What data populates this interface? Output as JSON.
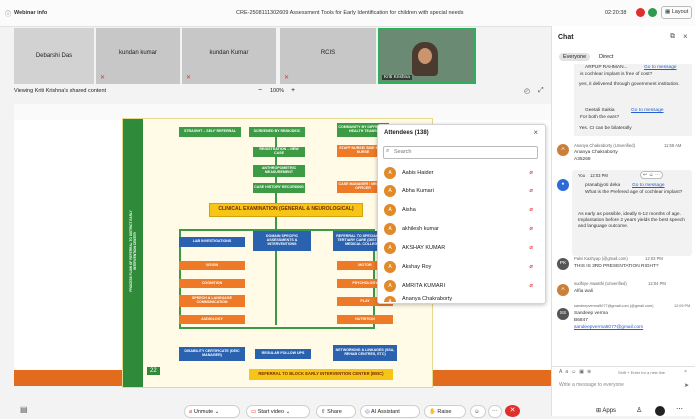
{
  "app": {
    "title": "Webinar info",
    "meeting_title": "CRE-2508111302609 Assessment Tools for Early Identification for children with special needs",
    "time": "02:20:38",
    "layout_label": "Layout"
  },
  "participants": [
    {
      "name": "Debarshi Das"
    },
    {
      "name": "kundan kumar"
    },
    {
      "name": "kundan Kumar"
    },
    {
      "name": "RCIS"
    },
    {
      "name": "Kriti Krishna"
    }
  ],
  "share": {
    "label": "Viewing Kriti Krishna's shared content",
    "zoom": "100%",
    "minus": "−",
    "plus": "+"
  },
  "slide": {
    "vertical_text": "PROCESS FLOW OF REFERRAL TO DISTRICT EARLY INTERVENTION CENTER",
    "page_number": "22",
    "boxes": {
      "b1": "STRAIGHT – SELF REFERRAL",
      "b2": "SCREENED BY RBSK/DEIC",
      "b3": "COMMUNITY BY DIFFERENT HEALTH TEAMS",
      "b4": "REGISTRATION – NEW CASE",
      "b5": "STAFF NURSE/ SIDE STAFF NURSE",
      "b6": "ANTHROPOMETRIC MEASUREMENT",
      "b7": "CASE HISTORY RECORDING",
      "b8": "CASE MANAGER / MEDICAL OFFICER",
      "b9": "CLINICAL EXAMINATION (GENERAL & NEUROLOGICAL)",
      "b10": "LAB INVESTIGATIONS",
      "b11": "DOMAIN SPECIFIC ASSESSMENTS & INTERVENTIONS",
      "b12": "REFERRAL TO SPECIALISTS & TERTIARY CARE (DISTRICT & MEDICAL COLLEGE)",
      "l1": "VISION",
      "l2": "COGNITION",
      "l3": "SPEECH & LANGUAGE COMMUNICATION",
      "l4": "AUDIOLOGY",
      "r1": "MOTOR",
      "r2": "PSYCHOLOGY",
      "r3": "PLAY",
      "r4": "NUTRITION",
      "c1": "DISABILITY CERTIFICATE (DEIC MANAGER)",
      "c2": "REGULAR FOLLOW UPS",
      "c3": "NETWORKING & LINKAGES (SSA, REHAB CENTRES, ETC)",
      "foot": "REFERRAL TO BLOCK EARLY INTERVENTION CENTER (BEIC)"
    }
  },
  "attendees": {
    "title": "Attendees (138)",
    "search_placeholder": "Search",
    "list": [
      {
        "name": "Aabis Haider",
        "initial": "A"
      },
      {
        "name": "Abha Kumari",
        "initial": "A"
      },
      {
        "name": "Aisha",
        "initial": "A"
      },
      {
        "name": "akhilesh kumar",
        "initial": "A"
      },
      {
        "name": "AKSHAY KUMAR",
        "initial": "A"
      },
      {
        "name": "Akshay Roy",
        "initial": "A"
      },
      {
        "name": "AMRITA KUMARI",
        "initial": "A"
      },
      {
        "name": "Ananya Chakraborty",
        "initial": "A"
      }
    ]
  },
  "chat": {
    "title": "Chat",
    "tabs": [
      "Everyone",
      "Direct"
    ],
    "messages": {
      "m1_name": "ARPUP RAHMAN...",
      "m1_link": "Go to message",
      "m1_quote": "is cochlear implant is free of cost?",
      "m1_text": "yes, it delivered through government institution.",
      "m2_name": "Geetali Saikia",
      "m2_link": "Go to message",
      "m2_quote": "For both the ears?",
      "m2_text": "Yes. CI can be bilaterally",
      "m3_name": "Ananya Chakraborty (Unverified)",
      "m3_time": "11:58 AM",
      "m3_text": "Ananya Chakraborty",
      "m3_text2": "A35268",
      "m4_name": "You",
      "m4_time": "12:03 PM",
      "m4_quote_name": "pranabjyoti deka",
      "m4_link": "Go to message",
      "m4_quote": "What is the Prefered age of cochlear implant?",
      "m4_text": "As early as possible, ideally 6-12 months of age. Implantation before 2 years yields the best speech and language outcome.",
      "m5_name": "Palvi Kashyap (@gmail.com)",
      "m5_time": "12:03 PM",
      "m5_text": "THIS IS 3RD PRESENTATION RIGHT?",
      "m6_name": "sudhiye Awasthi (Unverified)",
      "m6_time": "12:04 PM",
      "m6_text": "Alfia wali",
      "m7_name": "sandeepverma5077@gmail.com (@gmail.com)",
      "m7_time": "12:09 PM",
      "m7_text": "Sandeep verma",
      "m7_text2": "B6847",
      "m7_link": "sandeepverma5077@gmail.com",
      "input_hint": "Shift + Enter for a new line",
      "placeholder": "Write a message to everyone"
    }
  },
  "toolbar": {
    "unmute": "Unmute",
    "video": "Start video",
    "share": "Share",
    "ai": "AI Assistant",
    "raise": "Raise",
    "apps": "Apps"
  },
  "colors": {
    "green": "#3d9a45",
    "orange": "#ee7a27",
    "blue": "#2b62b0",
    "yellow": "#f5c518",
    "end_red": "#e0302c"
  }
}
